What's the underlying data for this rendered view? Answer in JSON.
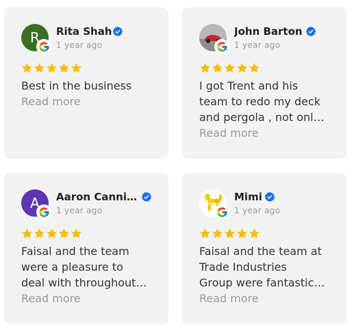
{
  "colors": {
    "card_bg": "#f2f2f2",
    "star": "#f6bb06",
    "verified": "#1a73e8",
    "muted": "#9a9a9a"
  },
  "reviews": [
    {
      "name": "Rita Shah",
      "date": "1 year ago",
      "rating": 5,
      "avatar": {
        "initial": "R",
        "color": "#3c6e22"
      },
      "text_lines": [
        "Best in the business"
      ],
      "read_more": "Read more"
    },
    {
      "name": "John Barton",
      "date": "1 year ago",
      "rating": 5,
      "avatar": {
        "initial": "",
        "color": "#cfcfcf"
      },
      "text_lines": [
        "I got Trent and his",
        "team to redo my deck",
        "and pergola , not onl…"
      ],
      "read_more": "Read more"
    },
    {
      "name": "Aaron Canni…",
      "date": "1 year ago",
      "rating": 5,
      "avatar": {
        "initial": "A",
        "color": "#5e35b1"
      },
      "text_lines": [
        "Faisal and the team",
        "were a pleasure to",
        "deal with throughout…"
      ],
      "read_more": "Read more"
    },
    {
      "name": "Mimi",
      "date": "1 year ago",
      "rating": 5,
      "avatar": {
        "initial": "",
        "color": "#ffffff"
      },
      "text_lines": [
        "Faisal and the team at",
        "Trade Industries",
        "Group were fantastic…"
      ],
      "read_more": "Read more"
    }
  ]
}
